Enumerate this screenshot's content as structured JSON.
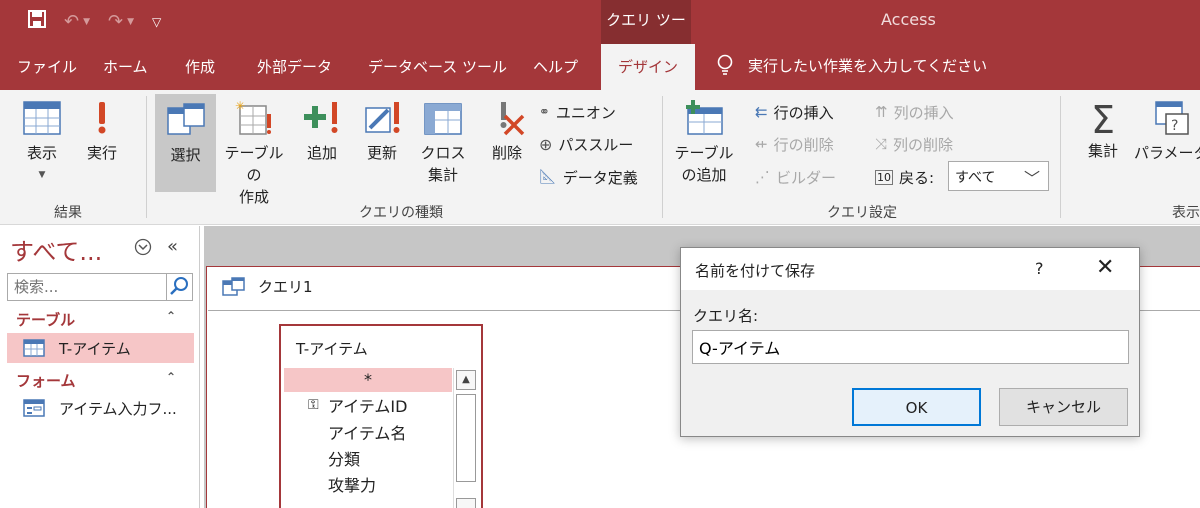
{
  "app": {
    "title": "Access",
    "contextual_tab_group": "クエリ ツール"
  },
  "tabs": [
    "ファイル",
    "ホーム",
    "作成",
    "外部データ",
    "データベース ツール",
    "ヘルプ",
    "デザイン"
  ],
  "active_tab": "デザイン",
  "tell_me": "実行したい作業を入力してください",
  "ribbon": {
    "results": {
      "label": "結果",
      "view": "表示",
      "run": "実行"
    },
    "query_type": {
      "label": "クエリの種類",
      "select": "選択",
      "make_table": "テーブルの\n作成",
      "append": "追加",
      "update": "更新",
      "crosstab": "クロス\n集計",
      "delete": "削除",
      "union": "ユニオン",
      "passthrough": "パススルー",
      "data_definition": "データ定義"
    },
    "query_setup": {
      "label": "クエリ設定",
      "show_table": "テーブル\nの追加",
      "insert_rows": "行の挿入",
      "delete_rows": "行の削除",
      "builder": "ビルダー",
      "insert_columns": "列の挿入",
      "delete_columns": "列の削除",
      "return_label": "戻る:",
      "return_value": "すべて"
    },
    "show_hide": {
      "label": "表示",
      "totals": "集計",
      "parameters": "パラメータ"
    }
  },
  "nav_pane": {
    "title": "すべて...",
    "search_placeholder": "検索...",
    "groups": [
      {
        "name": "テーブル",
        "items": [
          "T-アイテム"
        ]
      },
      {
        "name": "フォーム",
        "items": [
          "アイテム入力フ..."
        ]
      }
    ]
  },
  "document": {
    "tab_title": "クエリ1",
    "field_list": {
      "table": "T-アイテム",
      "fields": [
        "*",
        "アイテムID",
        "アイテム名",
        "分類",
        "攻撃力"
      ]
    }
  },
  "dialog": {
    "title": "名前を付けて保存",
    "help": "?",
    "field_label": "クエリ名:",
    "value": "Q-アイテム",
    "ok": "OK",
    "cancel": "キャンセル"
  },
  "colors": {
    "accent": "#a4373a",
    "contextual": "#862e30",
    "ribbon_bg": "#f3f3f3",
    "selection": "#f6c6c7",
    "ok_border": "#0078d7"
  }
}
